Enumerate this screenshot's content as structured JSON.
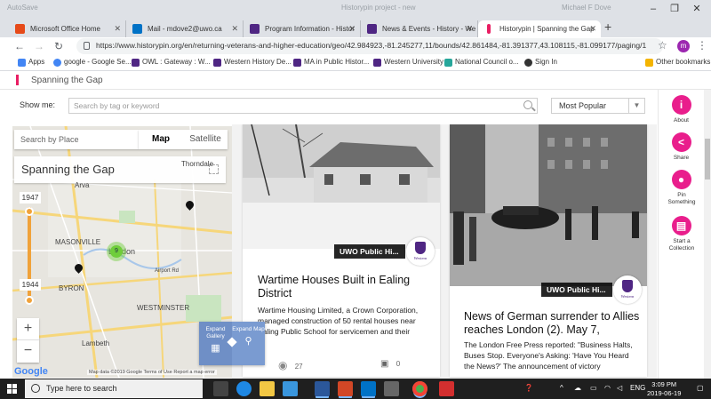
{
  "window": {
    "autosave": "AutoSave",
    "title": "Historypin project - new",
    "user": "Michael F Dove",
    "minimize_icon": "minimize-icon",
    "maximize_icon": "maximize-icon",
    "close_icon": "close-icon"
  },
  "tabs": [
    {
      "label": "Microsoft Office Home",
      "color": "#e64a19"
    },
    {
      "label": "Mail - mdove2@uwo.ca",
      "color": "#0072c6"
    },
    {
      "label": "Program Information - Histor",
      "color": "#4f2683"
    },
    {
      "label": "News & Events - History - We",
      "color": "#4f2683"
    },
    {
      "label": "Historypin | Spanning the Gap",
      "color": "#e91e63"
    }
  ],
  "new_tab": "+",
  "address": {
    "url": "https://www.historypin.org/en/returning-veterans-and-higher-education/geo/42.984923,-81.245277,11/bounds/42.861484,-81.391377,43.108115,-81.099177/paging/1",
    "profile_initial": "m"
  },
  "bookmarks": [
    {
      "label": "Apps",
      "color": "#4285f4"
    },
    {
      "label": "google - Google Se...",
      "color": "#4285f4"
    },
    {
      "label": "OWL : Gateway : W...",
      "color": "#4f2683"
    },
    {
      "label": "Western History De...",
      "color": "#4f2683"
    },
    {
      "label": "MA in Public Histor...",
      "color": "#4f2683"
    },
    {
      "label": "Western University",
      "color": "#4f2683"
    },
    {
      "label": "National Council o...",
      "color": "#26a69a"
    },
    {
      "label": "Sign In",
      "color": "#333333"
    },
    {
      "label": "Other bookmarks",
      "color": "#f4b400"
    }
  ],
  "site": {
    "project_name": "Spanning the Gap",
    "show_me_label": "Show me:",
    "search_placeholder": "Search by tag or keyword",
    "sort_value": "Most Popular",
    "accent": "#e91e8c"
  },
  "map": {
    "search_placeholder": "Search by Place",
    "type_map": "Map",
    "type_satellite": "Satellite",
    "title": "Spanning the Gap",
    "year_start": "1947",
    "year_end": "1944",
    "zoom_in": "+",
    "zoom_out": "−",
    "cluster_count": "9",
    "cities": [
      "Arva",
      "MASONVILLE",
      "London",
      "BYRON",
      "WESTMINSTER",
      "Airport Rd",
      "Lambeth",
      "Thorndale"
    ],
    "google": "Google",
    "attribution": "Map data ©2019 Google   Terms of Use   Report a map error",
    "expand_gallery": "Expand Gallery",
    "expand_map": "Expand Map"
  },
  "cards": [
    {
      "credit": "UWO Public Hi...",
      "crest_text": "Western",
      "title": "Wartime Houses Built in Ealing District",
      "description": "Wartime Housing Limited, a Crown Corporation, managed construction of 50 rental houses near Ealing Public School for servicemen and their",
      "views": "27",
      "comments": "0"
    },
    {
      "credit": "UWO Public Hi...",
      "crest_text": "Western",
      "title": "News of German surrender to Allies reaches London (2). May 7,",
      "description": "The London Free Press reported: \"Business Halts, Buses Stop. Everyone's Asking: 'Have You Heard the News?' The announcement of victory"
    }
  ],
  "rail": [
    {
      "label": "About",
      "glyph": "i"
    },
    {
      "label": "Share",
      "glyph": "<"
    },
    {
      "label": "Pin Something",
      "glyph": "●"
    },
    {
      "label": "Start a Collection",
      "glyph": "▤"
    }
  ],
  "taskbar": {
    "search_placeholder": "Type here to search",
    "apps": [
      {
        "name": "task-view",
        "color": "#444444"
      },
      {
        "name": "edge",
        "color": "#1e88e5"
      },
      {
        "name": "file-explorer",
        "color": "#f2c744"
      },
      {
        "name": "store",
        "color": "#3a96dd"
      },
      {
        "name": "word",
        "color": "#2b579a"
      },
      {
        "name": "powerpoint",
        "color": "#d24726"
      },
      {
        "name": "outlook",
        "color": "#0072c6"
      },
      {
        "name": "photos",
        "color": "#666666"
      },
      {
        "name": "chrome",
        "color": "#4caf50"
      },
      {
        "name": "acrobat",
        "color": "#d32f2f"
      }
    ],
    "lang": "ENG",
    "time": "3:09 PM",
    "date": "2019-06-19"
  }
}
